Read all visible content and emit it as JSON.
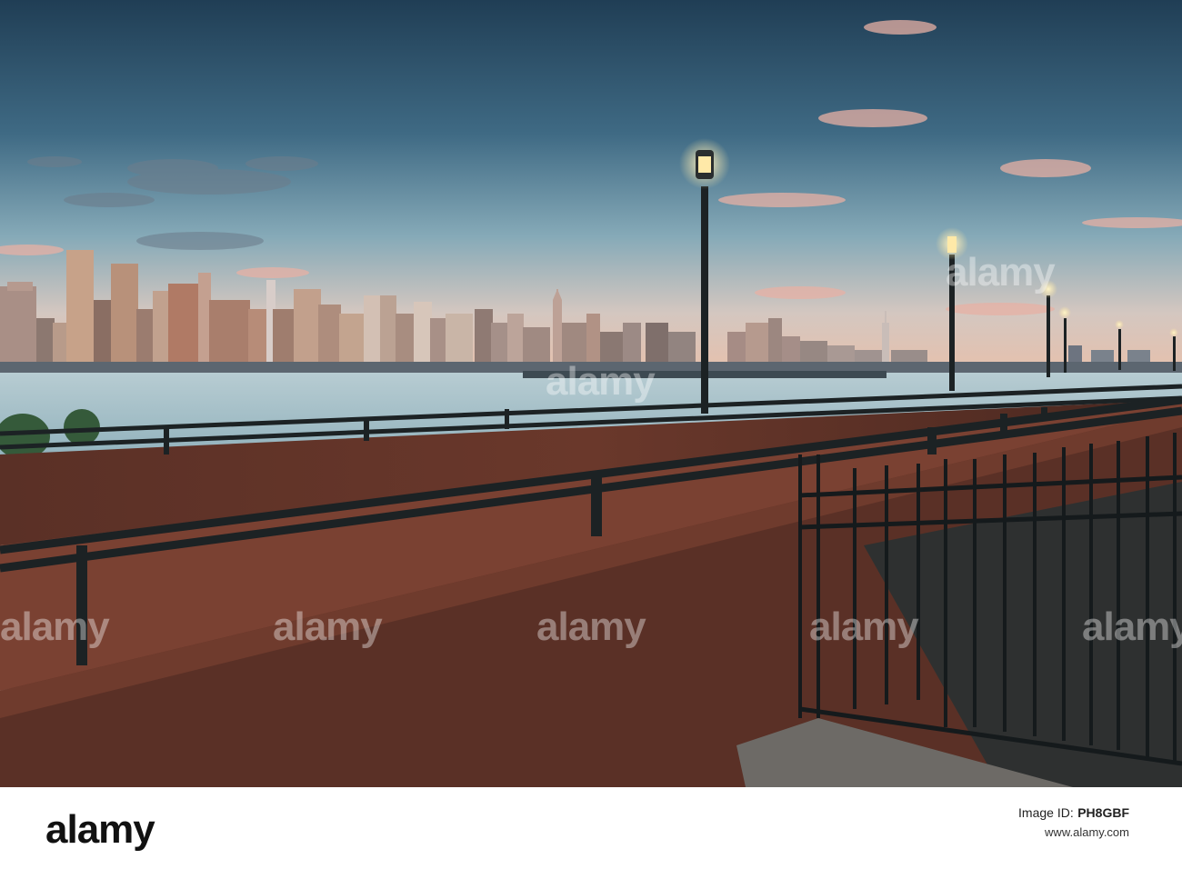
{
  "watermark": {
    "text": "alamy"
  },
  "footer": {
    "logo_text": "alamy",
    "id_label": "Image ID:",
    "id_code": "PH8GBF",
    "site": "www.alamy.com"
  },
  "colors": {
    "sky_top": "#2a4a63",
    "sky_mid": "#5f8aa0",
    "sky_horizon": "#e8c7b3",
    "water": "#a8c3cc",
    "rust": "#6b3a2c",
    "rust_deck": "#7c4233",
    "rail": "#1e2426",
    "lamp_glow": "#ffe6a0"
  }
}
